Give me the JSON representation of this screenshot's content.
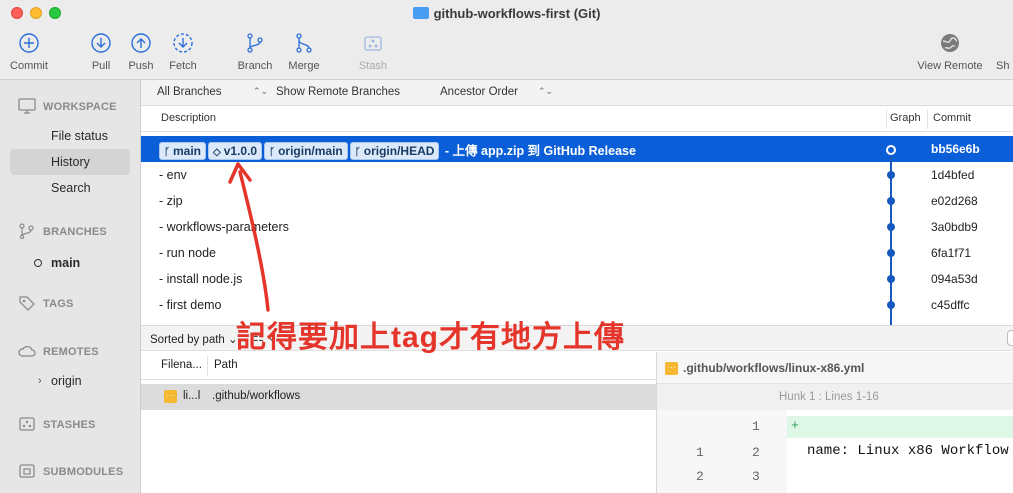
{
  "window": {
    "title": "github-workflows-first (Git)"
  },
  "toolbar": {
    "commit": "Commit",
    "pull": "Pull",
    "push": "Push",
    "fetch": "Fetch",
    "branch": "Branch",
    "merge": "Merge",
    "stash": "Stash",
    "view_remote": "View Remote",
    "show": "Sh"
  },
  "sidebar": {
    "workspace": "WORKSPACE",
    "file_status": "File status",
    "history": "History",
    "search": "Search",
    "branches": "BRANCHES",
    "branch_main": "main",
    "tags": "TAGS",
    "remotes": "REMOTES",
    "remote_origin": "origin",
    "stashes": "STASHES",
    "submodules": "SUBMODULES"
  },
  "filters": {
    "branches": "All Branches",
    "remote": "Show Remote Branches",
    "order": "Ancestor Order"
  },
  "columns": {
    "description": "Description",
    "graph": "Graph",
    "commit": "Commit"
  },
  "commits": [
    {
      "tags": [
        "main",
        "v1.0.0",
        "origin/main",
        "origin/HEAD"
      ],
      "message": "- 上傳 app.zip 到 GitHub Release",
      "hash": "bb56e6b"
    },
    {
      "message": "- env",
      "hash": "1d4bfed"
    },
    {
      "message": "- zip",
      "hash": "e02d268"
    },
    {
      "message": "- workflows-parameters",
      "hash": "3a0bdb9"
    },
    {
      "message": "- run node",
      "hash": "6fa1f71"
    },
    {
      "message": "- install node.js",
      "hash": "094a53d"
    },
    {
      "message": "- first demo",
      "hash": "c45dffc"
    }
  ],
  "files": {
    "sorted": "Sorted by path",
    "col_filename": "Filena...",
    "col_path": "Path",
    "row_name": "li...l",
    "row_path": ".github/workflows"
  },
  "diff": {
    "file": ".github/workflows/linux-x86.yml",
    "hunk": "Hunk 1 : Lines 1-16",
    "lines": [
      {
        "old": "",
        "new": "1",
        "text": "+"
      },
      {
        "old": "1",
        "new": "2",
        "text": "name: Linux x86 Workflow"
      },
      {
        "old": "2",
        "new": "3",
        "text": ""
      }
    ]
  },
  "annotation": "記得要加上tag才有地方上傳",
  "colors": {
    "selection": "#0a5fd8",
    "graph": "#1659bf",
    "annotation": "#e5352b"
  }
}
